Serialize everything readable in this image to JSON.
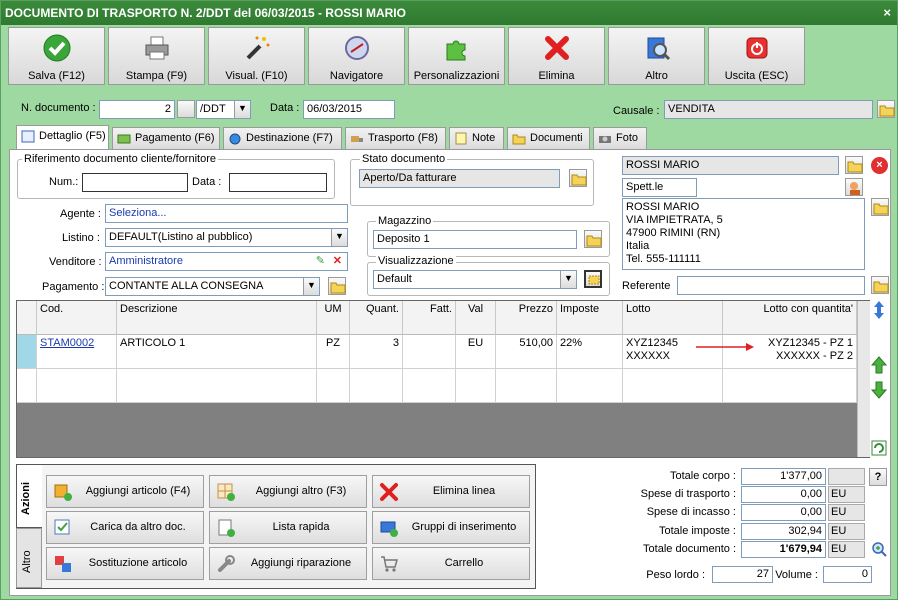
{
  "window": {
    "title": "DOCUMENTO DI TRASPORTO N. 2/DDT del 06/03/2015 - ROSSI MARIO",
    "close": "×"
  },
  "toolbar": [
    {
      "label": "Salva (F12)",
      "icon": "check-icon"
    },
    {
      "label": "Stampa (F9)",
      "icon": "printer-icon"
    },
    {
      "label": "Visual. (F10)",
      "icon": "magic-wand-icon"
    },
    {
      "label": "Navigatore",
      "icon": "compass-icon"
    },
    {
      "label": "Personalizzazioni",
      "icon": "puzzle-icon"
    },
    {
      "label": "Elimina",
      "icon": "delete-x-icon"
    },
    {
      "label": "Altro",
      "icon": "book-search-icon"
    },
    {
      "label": "Uscita (ESC)",
      "icon": "power-icon"
    }
  ],
  "header": {
    "ndoc_label": "N. documento :",
    "ndoc_value": "2",
    "series_value": "/DDT",
    "data_label": "Data :",
    "data_value": "06/03/2015",
    "causale_label": "Causale :",
    "causale_value": "VENDITA"
  },
  "tabs": [
    "Dettaglio (F5)",
    "Pagamento (F6)",
    "Destinazione (F7)",
    "Trasporto (F8)",
    "Note",
    "Documenti",
    "Foto"
  ],
  "riferimento": {
    "title": "Riferimento documento cliente/fornitore",
    "num_label": "Num.:",
    "num_value": "",
    "data_label": "Data :",
    "data_value": ""
  },
  "stato": {
    "title": "Stato documento",
    "value": "Aperto/Da fatturare"
  },
  "magazzino": {
    "title": "Magazzino",
    "value": "Deposito 1"
  },
  "visualizzazione": {
    "title": "Visualizzazione",
    "value": "Default"
  },
  "fields": {
    "agente_label": "Agente :",
    "agente_value": "Seleziona...",
    "listino_label": "Listino :",
    "listino_value": "DEFAULT(Listino al pubblico)",
    "venditore_label": "Venditore :",
    "venditore_value": "Amministratore",
    "pagamento_label": "Pagamento :",
    "pagamento_value": "CONTANTE ALLA CONSEGNA"
  },
  "cliente": {
    "name": "ROSSI MARIO",
    "salutation": "Spett.le",
    "address": [
      "ROSSI MARIO",
      "VIA IMPIETRATA, 5",
      "47900 RIMINI (RN)",
      "Italia",
      "Tel. 555-111111"
    ],
    "referente_label": "Referente",
    "referente_value": ""
  },
  "grid": {
    "headers": [
      "Cod.",
      "Descrizione",
      "UM",
      "Quant.",
      "Fatt.",
      "Val",
      "Prezzo",
      "Imposte",
      "Lotto",
      "Lotto con quantita'"
    ],
    "row": {
      "cod": "STAM0002",
      "descrizione": "ARTICOLO 1",
      "um": "PZ",
      "quant": "3",
      "fatt": "",
      "val": "EU",
      "prezzo": "510,00",
      "imposte": "22%",
      "lotto1": "XYZ12345",
      "lotto2": "XXXXXX",
      "lq1": "XYZ12345 - PZ 1",
      "lq2": "XXXXXX - PZ 2"
    }
  },
  "side_tabs": [
    "Azioni",
    "Altro"
  ],
  "actions": [
    {
      "label": "Aggiungi articolo (F4)",
      "icon": "add-box-icon"
    },
    {
      "label": "Aggiungi altro (F3)",
      "icon": "add-grid-icon"
    },
    {
      "label": "Elimina linea",
      "icon": "delete-line-icon"
    },
    {
      "label": "Carica da altro doc.",
      "icon": "load-doc-icon"
    },
    {
      "label": "Lista rapida",
      "icon": "quick-list-icon"
    },
    {
      "label": "Gruppi di inserimento",
      "icon": "groups-icon"
    },
    {
      "label": "Sostituzione articolo",
      "icon": "replace-icon"
    },
    {
      "label": "Aggiungi riparazione",
      "icon": "wrench-icon"
    },
    {
      "label": "Carrello",
      "icon": "cart-icon"
    }
  ],
  "totals": {
    "corpo_label": "Totale corpo :",
    "corpo": "1'377,00",
    "help": "?",
    "trasporto_label": "Spese di trasporto :",
    "trasporto": "0,00",
    "trasporto_u": "EU",
    "incasso_label": "Spese di incasso :",
    "incasso": "0,00",
    "incasso_u": "EU",
    "imposte_label": "Totale imposte :",
    "imposte": "302,94",
    "imposte_u": "EU",
    "documento_label": "Totale documento :",
    "documento": "1'679,94",
    "documento_u": "EU",
    "peso_label": "Peso lordo :",
    "peso": "27",
    "volume_label": "Volume :",
    "volume": "0"
  }
}
